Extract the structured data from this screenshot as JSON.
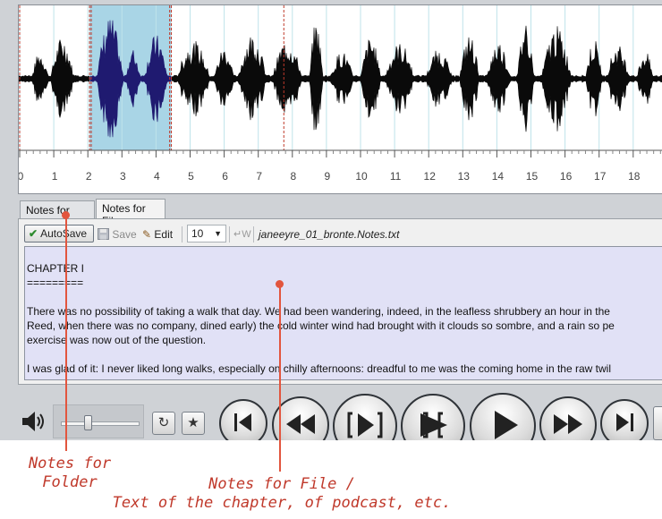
{
  "waveform": {
    "ruler_ticks": [
      "0",
      "1",
      "2",
      "3",
      "4",
      "5",
      "6",
      "7",
      "8",
      "9",
      "10",
      "11",
      "12",
      "13",
      "14",
      "15",
      "16",
      "17",
      "18"
    ],
    "selection_start_sec": 2.05,
    "selection_end_sec": 4.45,
    "marker_times_sec": [
      0,
      2.05,
      2.1,
      4.4,
      4.45,
      7.75
    ],
    "seconds_visible": 18.6,
    "colors": {
      "selection": "#a9d5e6",
      "marker": "#c0392b",
      "wave": "#0a0a0a",
      "wave_selected": "#1f1a70"
    }
  },
  "tabs": [
    {
      "label": "Notes for Folder",
      "active": false
    },
    {
      "label": "Notes for File",
      "active": true
    }
  ],
  "toolbar": {
    "autosave_label": "AutoSave",
    "save_label": "Save",
    "edit_label": "Edit",
    "font_size": "10",
    "wrap_symbol": "↵W",
    "filename": "janeeyre_01_bronte.Notes.txt"
  },
  "notes_text": [
    "CHAPTER I",
    "=========",
    "",
    "There was no possibility of taking a walk that day.  We had been wandering, indeed, in the leafless shrubbery an hour in the",
    "Reed, when there was no company, dined early) the cold winter wind had brought with it clouds so sombre, and a rain so pe",
    "exercise was now out of the question.",
    "",
    "I was glad of it: I never liked long walks, especially on chilly afternoons: dreadful to me was the coming home in the raw twil"
  ],
  "annotations": {
    "folder_line1": "Notes for",
    "folder_line2": "Folder",
    "file_line1": "Notes for File /",
    "file_line2": "Text of the chapter, of podcast, etc."
  },
  "volume": {
    "level": 0.33
  },
  "icons": [
    "check-icon",
    "save-icon",
    "edit-pencil-icon",
    "wrap-icon",
    "speaker-icon",
    "repeat-icon",
    "star-icon",
    "skip-start-icon",
    "rewind-icon",
    "play-selection-icon",
    "play-around-icon",
    "play-icon",
    "fast-forward-icon",
    "skip-end-icon"
  ]
}
